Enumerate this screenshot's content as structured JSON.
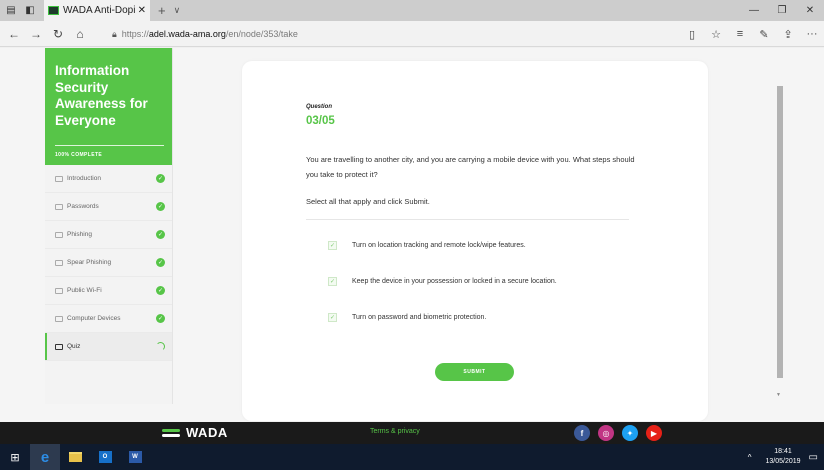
{
  "browser": {
    "tab_title": "WADA Anti-Doping eLe",
    "url_prefix": "https://",
    "url_domain": "adel.wada-ama.org",
    "url_path": "/en/node/353/take"
  },
  "sidebar": {
    "title": "Information Security Awareness for Everyone",
    "progress": "100% COMPLETE",
    "items": [
      {
        "label": "Introduction"
      },
      {
        "label": "Passwords"
      },
      {
        "label": "Phishing"
      },
      {
        "label": "Spear Phishing"
      },
      {
        "label": "Public Wi-Fi"
      },
      {
        "label": "Computer Devices"
      },
      {
        "label": "Quiz"
      }
    ]
  },
  "question": {
    "label": "Question",
    "number": "03/05",
    "text": "You are travelling to another city, and you are carrying a mobile device with you. What steps should you take to protect it?",
    "instruction": "Select all that apply and click Submit.",
    "options": [
      {
        "text": "Turn on location tracking and remote lock/wipe features."
      },
      {
        "text": "Keep the device in your possession or locked in a secure location."
      },
      {
        "text": "Turn on password and biometric protection."
      }
    ],
    "submit_label": "SUBMIT"
  },
  "footer": {
    "logo_text": "WADA",
    "terms": "Terms & privacy"
  },
  "taskbar": {
    "time": "18:41",
    "date": "13/05/2019"
  },
  "colors": {
    "accent": "#57c548",
    "footer_bg": "#1a1a1a",
    "taskbar_bg": "#0f1b2e",
    "facebook": "#3b5998",
    "instagram": "#c13584",
    "twitter": "#1da1f2",
    "youtube": "#e62117"
  },
  "icons": {
    "social": [
      "facebook-icon",
      "instagram-icon",
      "twitter-icon",
      "youtube-icon"
    ]
  }
}
